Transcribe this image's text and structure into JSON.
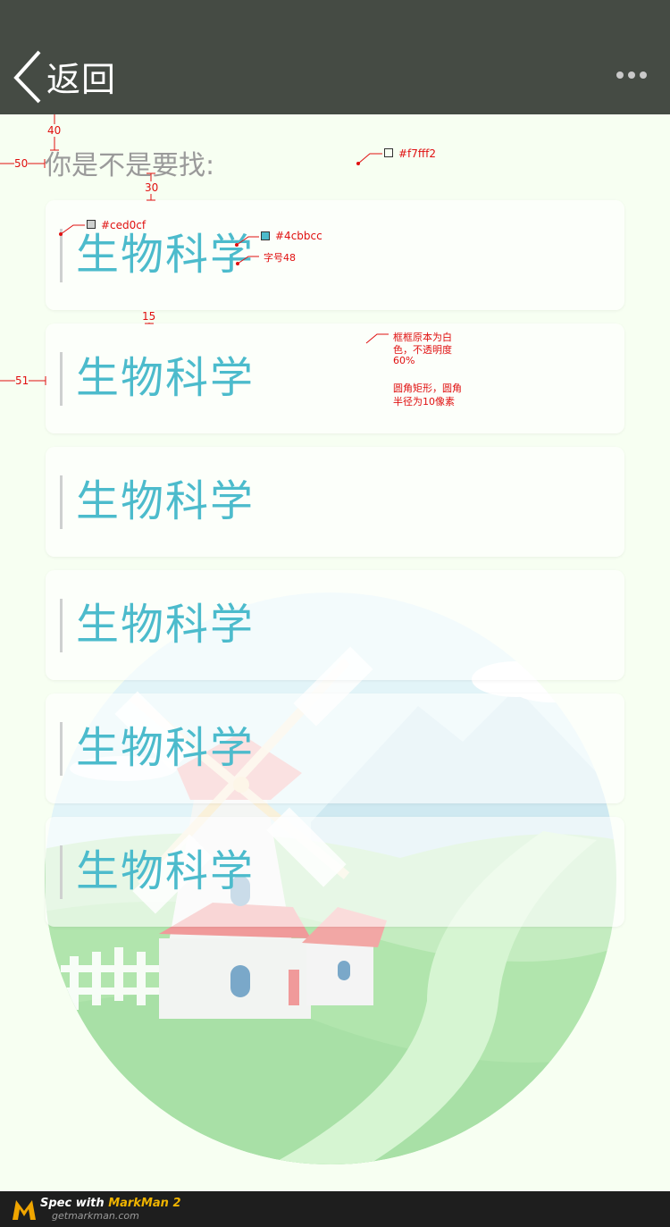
{
  "header": {
    "back_label": "返回",
    "back_icon": "chevron-left-icon",
    "more_icon": "more-horizontal-icon"
  },
  "prompt": "你是不是要找:",
  "cards": [
    {
      "label": "生物科学"
    },
    {
      "label": "生物科学"
    },
    {
      "label": "生物科学"
    },
    {
      "label": "生物科学"
    },
    {
      "label": "生物科学"
    },
    {
      "label": "生物科学"
    }
  ],
  "colors": {
    "header_bg": "#454b44",
    "page_bg": "#f7fff2",
    "label": "#4cbbcc",
    "bar": "#ced0cf",
    "annotation": "#e01010"
  },
  "annotations": {
    "top_spacing": "40",
    "left_spacing": "50",
    "prompt_gap": "30",
    "card_gap": "15",
    "card_left": "51",
    "page_bg_color": "#f7fff2",
    "bar_color": "#ced0cf",
    "label_color": "#4cbbcc",
    "font_size_note": "字号48",
    "card_note_1": "框框原本为白",
    "card_note_2": "色，不透明度",
    "card_note_3": "60%",
    "card_note_4": "圆角矩形，圆角",
    "card_note_5": "半径为10像素"
  },
  "footer": {
    "spec_text": "Spec with ",
    "brand": "MarkMan 2",
    "url": "getmarkman.com"
  }
}
